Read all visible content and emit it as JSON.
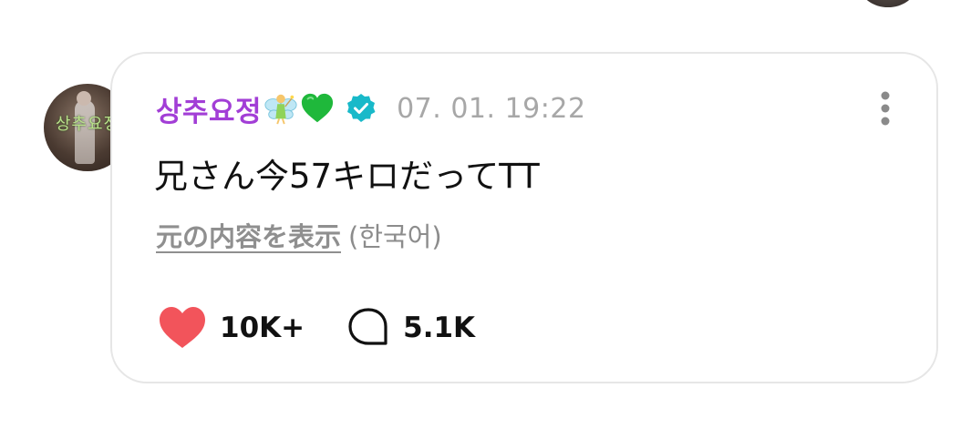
{
  "comment": {
    "username": "상추요정",
    "timestamp": "07. 01. 19:22",
    "text": "兄さん今57キロだってTT",
    "translate_link": "元の内容を表示",
    "original_language": "(한국어)",
    "likes": "10K+",
    "replies": "5.1K",
    "avatar_text": "상추요정"
  },
  "icons": {
    "fairy": "fairy-emoji-icon",
    "heart_emoji": "green-heart-emoji-icon",
    "verified": "verified-badge-icon",
    "more": "more-vertical-icon",
    "like": "heart-icon",
    "reply": "speech-bubble-icon"
  },
  "colors": {
    "username": "#a23ed6",
    "timestamp": "#a7a7a7",
    "like": "#f2545b",
    "verified": "#18b9c9",
    "green_heart": "#1fb83b",
    "card_border": "#e6e6e6"
  }
}
